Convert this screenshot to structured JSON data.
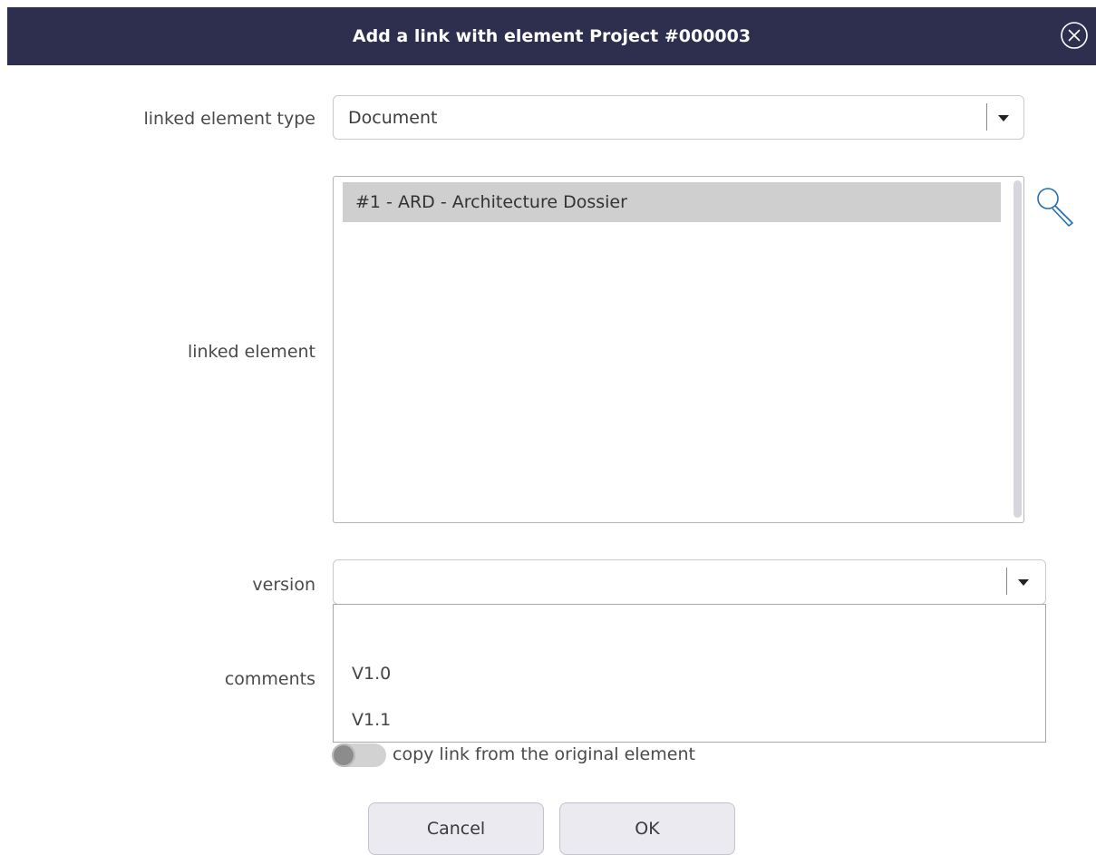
{
  "dialog": {
    "title": "Add a link with element Project #000003",
    "close_icon": "circle-x-icon"
  },
  "form": {
    "linked_element_type": {
      "label": "linked element type",
      "value": "Document"
    },
    "linked_element": {
      "label": "linked element",
      "items": [
        "#1 - ARD - Architecture Dossier"
      ],
      "selected_index": 0,
      "search_icon": "magnifier-icon"
    },
    "version": {
      "label": "version",
      "value": "",
      "options": [
        "",
        "V1.0",
        "V1.1"
      ]
    },
    "comments": {
      "label": "comments"
    },
    "copy_link": {
      "label": "copy link from the original element",
      "checked": false
    }
  },
  "buttons": {
    "cancel": "Cancel",
    "ok": "OK"
  },
  "colors": {
    "titlebar": "#2e2f4f",
    "selected_row": "#cfcfcf",
    "button_bg": "#eaeaf0"
  }
}
